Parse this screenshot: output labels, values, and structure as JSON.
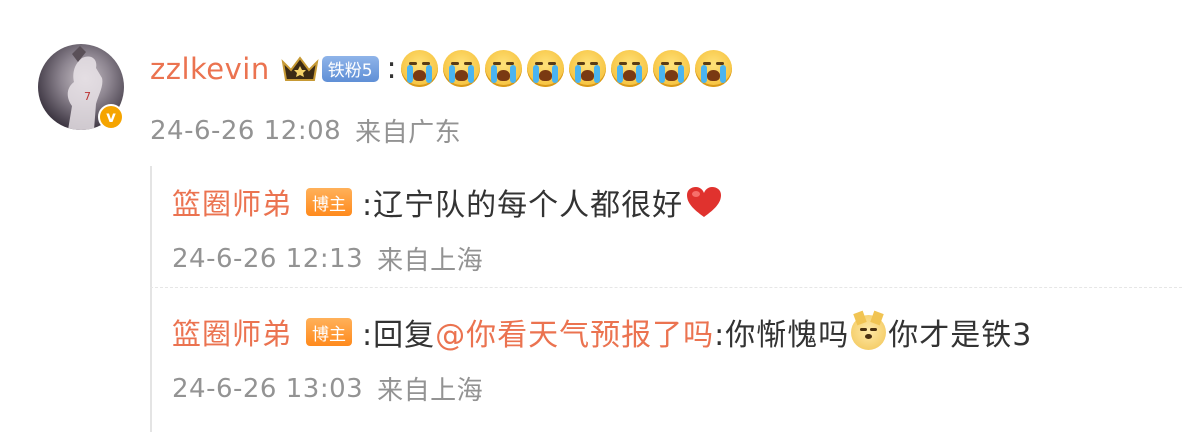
{
  "comment": {
    "username": "zzlkevin",
    "fan_badge": "铁粉5",
    "colon": ":",
    "emojis": [
      "crying-face",
      "crying-face",
      "crying-face",
      "crying-face",
      "crying-face",
      "crying-face",
      "crying-face",
      "crying-face"
    ],
    "timestamp": "24-6-26 12:08",
    "location": "来自广东"
  },
  "replies": [
    {
      "author": "篮圈师弟",
      "badge": "博主",
      "text": ":辽宁队的每个人都很好",
      "emoji": "red-heart",
      "timestamp": "24-6-26 12:13",
      "location": "来自上海"
    },
    {
      "author": "篮圈师弟",
      "badge": "博主",
      "prefix": ":回复",
      "mention": "@你看天气预报了吗",
      "text_before_emoji": ":你惭愧吗",
      "emoji": "doge",
      "text_after_emoji": "你才是铁3",
      "timestamp": "24-6-26 13:03",
      "location": "来自上海"
    }
  ],
  "colors": {
    "username": "#eb7350",
    "text": "#333333",
    "meta": "#939393",
    "verified": "#f5a400",
    "fan_badge": "#6f9adf",
    "host_badge": "#ff9a30"
  }
}
